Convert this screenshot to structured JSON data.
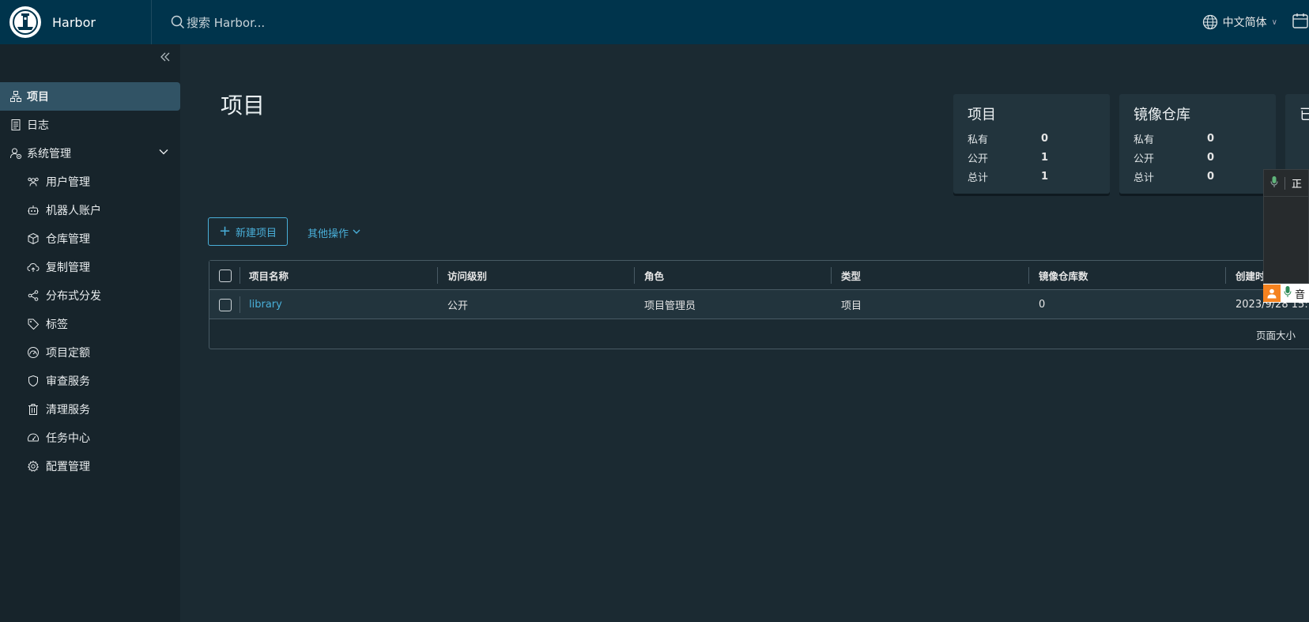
{
  "header": {
    "brand": "Harbor",
    "search_placeholder": "搜索 Harbor...",
    "language": "中文简体"
  },
  "sidebar": {
    "items": [
      {
        "label": "项目",
        "icon": "project-icon"
      },
      {
        "label": "日志",
        "icon": "log-icon"
      },
      {
        "label": "系统管理",
        "icon": "admin-icon"
      }
    ],
    "sub_items": [
      {
        "label": "用户管理",
        "icon": "users-icon"
      },
      {
        "label": "机器人账户",
        "icon": "robot-icon"
      },
      {
        "label": "仓库管理",
        "icon": "registry-icon"
      },
      {
        "label": "复制管理",
        "icon": "replication-icon"
      },
      {
        "label": "分布式分发",
        "icon": "share-icon"
      },
      {
        "label": "标签",
        "icon": "tag-icon"
      },
      {
        "label": "项目定额",
        "icon": "quota-icon"
      },
      {
        "label": "审查服务",
        "icon": "shield-icon"
      },
      {
        "label": "清理服务",
        "icon": "trash-icon"
      },
      {
        "label": "任务中心",
        "icon": "dashboard-icon"
      },
      {
        "label": "配置管理",
        "icon": "gear-icon"
      }
    ]
  },
  "main": {
    "title": "项目",
    "cards": [
      {
        "title": "项目",
        "rows": [
          {
            "k": "私有",
            "v": "0"
          },
          {
            "k": "公开",
            "v": "1"
          },
          {
            "k": "总计",
            "v": "1"
          }
        ]
      },
      {
        "title": "镜像仓库",
        "rows": [
          {
            "k": "私有",
            "v": "0"
          },
          {
            "k": "公开",
            "v": "0"
          },
          {
            "k": "总计",
            "v": "0"
          }
        ]
      },
      {
        "title": "已"
      }
    ],
    "new_project_label": "新建项目",
    "other_ops_label": "其他操作",
    "table": {
      "columns": [
        "项目名称",
        "访问级别",
        "角色",
        "类型",
        "镜像仓库数",
        "创建时"
      ],
      "rows": [
        {
          "name": "library",
          "access": "公开",
          "role": "项目管理员",
          "type": "项目",
          "repos": "0",
          "created": "2023/9/28 15:"
        }
      ],
      "footer": "页面大小"
    }
  },
  "float_widget": {
    "top_text": "正",
    "bottom_text": "音"
  },
  "colors": {
    "header_bg": "#00344c",
    "sidebar_bg": "#17242b",
    "main_bg": "#1b2a32",
    "accent": "#49afd9",
    "active_nav": "#315365"
  }
}
